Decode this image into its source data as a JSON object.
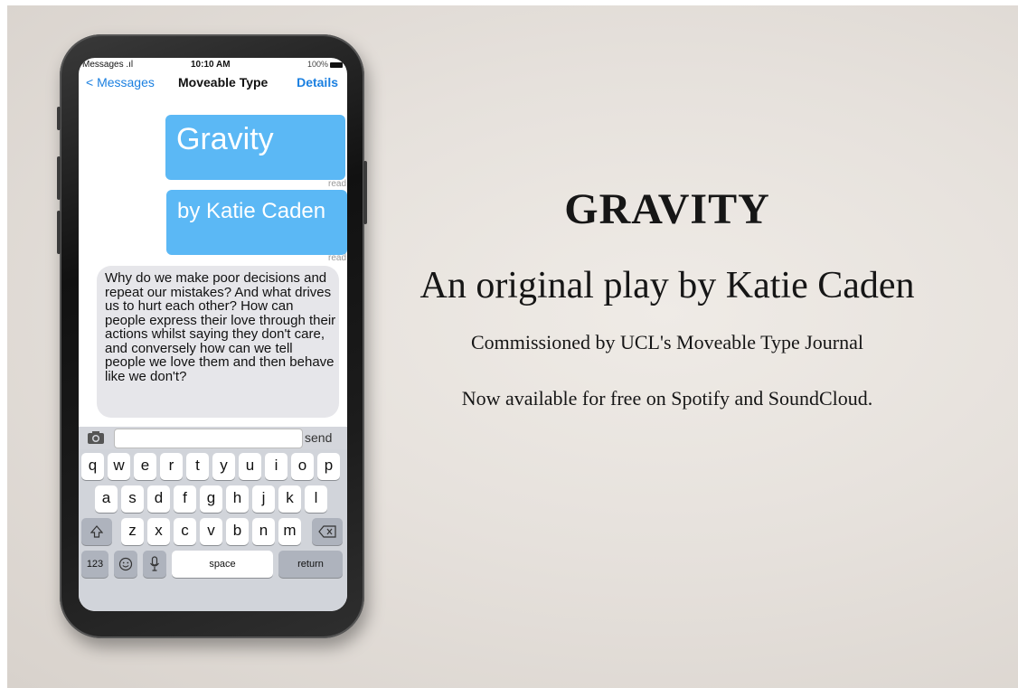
{
  "phone": {
    "status": {
      "left": "Messages .ıl",
      "time": "10:10 AM",
      "right": "100%"
    },
    "nav": {
      "back_label": "< Messages",
      "title": "Moveable Type",
      "details_label": "Details"
    },
    "messages": {
      "out1": "Gravity",
      "out2": "by Katie Caden",
      "read_label": "read",
      "in1": "Why do we make poor decisions and repeat our mistakes? And what drives us to hurt each other? How can people express their love through their actions whilst saying they don't care, and conversely how can we tell people we love them and then behave like we don't?"
    },
    "input": {
      "value": "",
      "send_label": "send"
    },
    "keyboard": {
      "row1": [
        "q",
        "w",
        "e",
        "r",
        "t",
        "y",
        "u",
        "i",
        "o",
        "p"
      ],
      "row2": [
        "a",
        "s",
        "d",
        "f",
        "g",
        "h",
        "j",
        "k",
        "l"
      ],
      "row3": [
        "z",
        "x",
        "c",
        "v",
        "b",
        "n",
        "m"
      ],
      "numbers_label": "123",
      "space_label": "space",
      "return_label": "return"
    }
  },
  "poster": {
    "title": "GRAVITY",
    "subtitle": "An original play by Katie Caden",
    "commission": "Commissioned by UCL's Moveable Type Journal",
    "availability": "Now available for free on Spotify and SoundCloud."
  }
}
